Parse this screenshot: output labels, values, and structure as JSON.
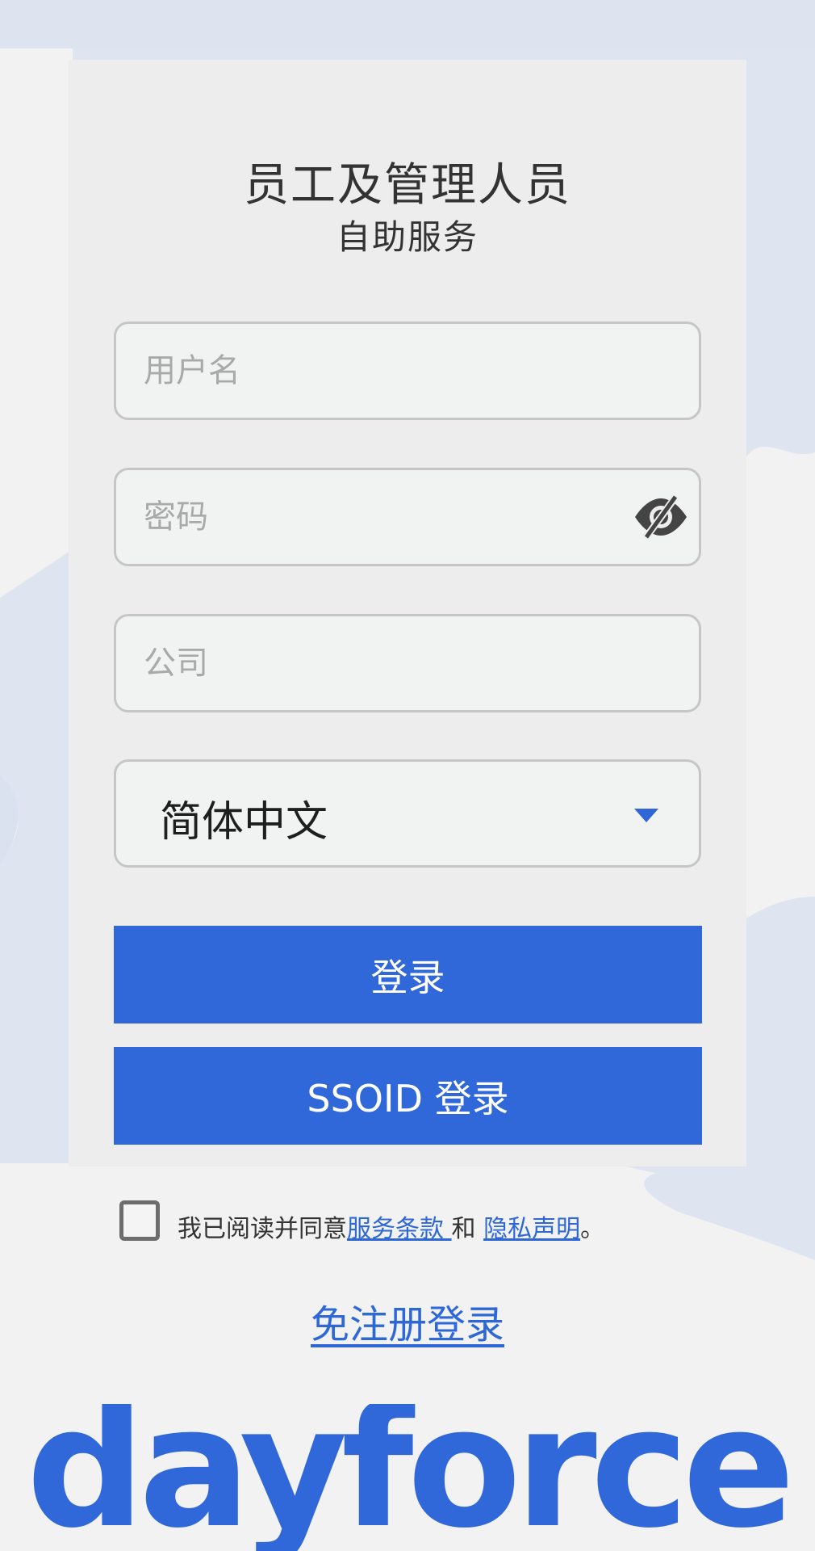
{
  "header": {
    "title": "员工及管理人员",
    "subtitle": "自助服务"
  },
  "form": {
    "username_placeholder": "用户名",
    "password_placeholder": "密码",
    "company_placeholder": "公司",
    "language_value": "简体中文"
  },
  "buttons": {
    "login": "登录",
    "sso_login": "SSOID 登录"
  },
  "agreement": {
    "prefix": "我已阅读并同意",
    "terms_link": "服务条款 ",
    "and": " 和 ",
    "privacy_link": "隐私声明",
    "suffix": "。"
  },
  "register_link": "免注册登录",
  "brand": {
    "logo_text": "dayforce",
    "accent_color": "#3068da"
  },
  "icons": {
    "password_toggle": "eye-slash-icon",
    "language_dropdown": "caret-down-icon"
  }
}
